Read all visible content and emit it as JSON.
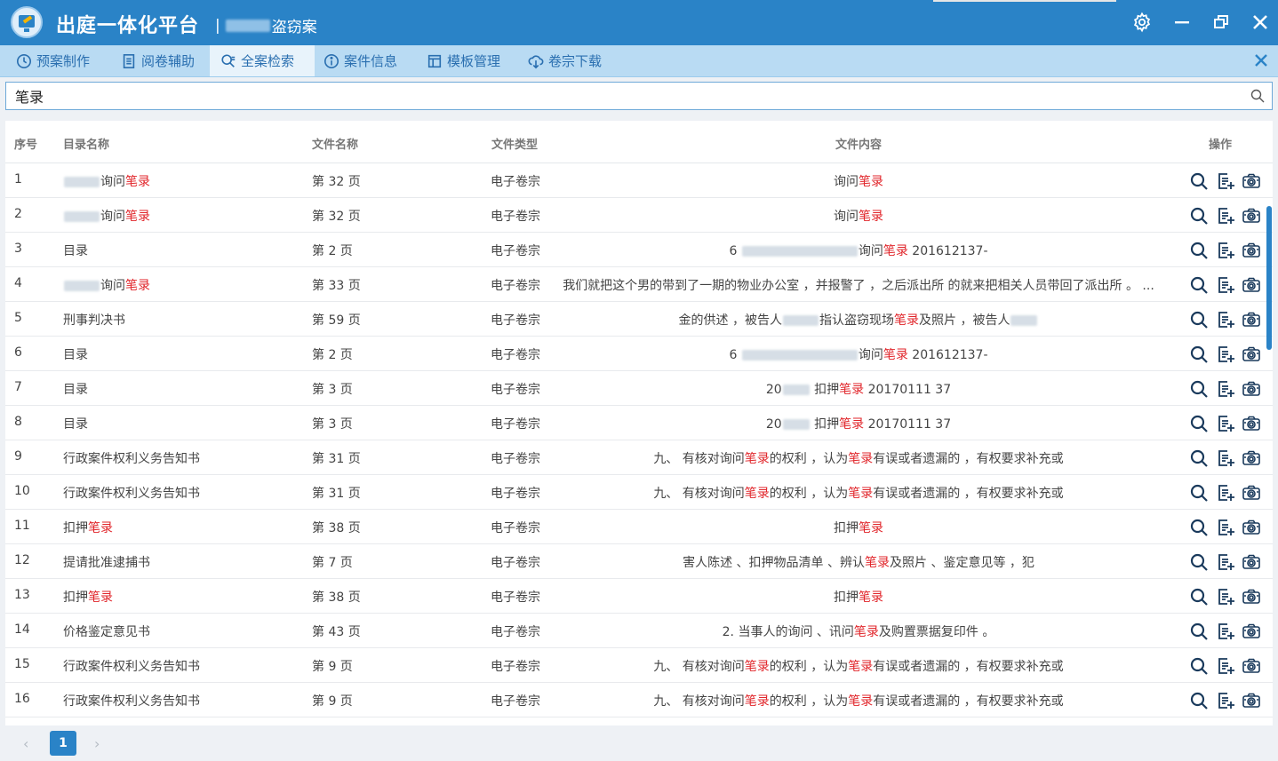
{
  "titlebar": {
    "app_title": "出庭一体化平台",
    "separator": "|",
    "case_title_suffix": "盗窃案",
    "settings_icon": "gear-icon",
    "minimize_icon": "minimize-icon",
    "maximize_icon": "restore-icon",
    "close_icon": "close-icon"
  },
  "tabs": [
    {
      "label": "预案制作",
      "icon": "clock-icon",
      "active": false
    },
    {
      "label": "阅卷辅助",
      "icon": "document-icon",
      "active": false
    },
    {
      "label": "全案检索",
      "icon": "search-doc-icon",
      "active": true
    },
    {
      "label": "案件信息",
      "icon": "info-icon",
      "active": false
    },
    {
      "label": "模板管理",
      "icon": "template-icon",
      "active": false
    },
    {
      "label": "卷宗下载",
      "icon": "cloud-download-icon",
      "active": false
    }
  ],
  "search": {
    "value": "笔录",
    "icon": "search-icon"
  },
  "table": {
    "headers": {
      "index": "序号",
      "catalog": "目录名称",
      "file_name": "文件名称",
      "file_type": "文件类型",
      "content": "文件内容",
      "actions": "操作"
    },
    "rows": [
      {
        "index": "1",
        "catalog": [
          "询问",
          "笔录"
        ],
        "catalog_blur": true,
        "file_name": "第 32 页",
        "file_type": "电子卷宗",
        "content": [
          "询问",
          "笔录"
        ]
      },
      {
        "index": "2",
        "catalog": [
          "询问",
          "笔录"
        ],
        "catalog_blur": true,
        "file_name": "第 32 页",
        "file_type": "电子卷宗",
        "content": [
          "询问",
          "笔录"
        ]
      },
      {
        "index": "3",
        "catalog": [
          "目录",
          ""
        ],
        "catalog_blur": false,
        "file_name": "第 2 页",
        "file_type": "电子卷宗",
        "content": [
          "6 ",
          "询问",
          "笔录",
          " 201612137-"
        ],
        "content_blur": true
      },
      {
        "index": "4",
        "catalog": [
          "询问",
          "笔录"
        ],
        "catalog_blur": true,
        "file_name": "第 33 页",
        "file_type": "电子卷宗",
        "content_plain": "我们就把这个男的带到了一期的物业办公室 ，并报警了 ，之后派出所 的就来把相关人员带回了派出所 。 ..."
      },
      {
        "index": "5",
        "catalog": [
          "刑事判决书",
          ""
        ],
        "catalog_blur": false,
        "file_name": "第 59 页",
        "file_type": "电子卷宗",
        "content": [
          "金的供述 ，被告人",
          "指认盗窃现场",
          "笔录",
          "及照片 ，被告人"
        ],
        "content_blur": true
      },
      {
        "index": "6",
        "catalog": [
          "目录",
          ""
        ],
        "catalog_blur": false,
        "file_name": "第 2 页",
        "file_type": "电子卷宗",
        "content": [
          "6 ",
          "询问",
          "笔录",
          " 201612137-"
        ],
        "content_blur": true
      },
      {
        "index": "7",
        "catalog": [
          "目录",
          ""
        ],
        "catalog_blur": false,
        "file_name": "第 3 页",
        "file_type": "电子卷宗",
        "content": [
          "20",
          " 扣押",
          "笔录",
          " 20170111 37"
        ],
        "content_blur": true
      },
      {
        "index": "8",
        "catalog": [
          "目录",
          ""
        ],
        "catalog_blur": false,
        "file_name": "第 3 页",
        "file_type": "电子卷宗",
        "content": [
          "20",
          " 扣押",
          "笔录",
          " 20170111 37"
        ],
        "content_blur": true
      },
      {
        "index": "9",
        "catalog": [
          "行政案件权利义务告知书",
          ""
        ],
        "catalog_blur": false,
        "file_name": "第 31 页",
        "file_type": "电子卷宗",
        "content_parts": [
          "九、 有核对询问",
          "笔录",
          "的权利 ，认为",
          "笔录",
          "有误或者遗漏的 ，有权要求补充或"
        ]
      },
      {
        "index": "10",
        "catalog": [
          "行政案件权利义务告知书",
          ""
        ],
        "catalog_blur": false,
        "file_name": "第 31 页",
        "file_type": "电子卷宗",
        "content_parts": [
          "九、 有核对询问",
          "笔录",
          "的权利 ，认为",
          "笔录",
          "有误或者遗漏的 ，有权要求补充或"
        ]
      },
      {
        "index": "11",
        "catalog": [
          "扣押",
          "笔录"
        ],
        "catalog_blur": false,
        "file_name": "第 38 页",
        "file_type": "电子卷宗",
        "content": [
          "扣押",
          "笔录"
        ]
      },
      {
        "index": "12",
        "catalog": [
          "提请批准逮捕书",
          ""
        ],
        "catalog_blur": false,
        "file_name": "第 7 页",
        "file_type": "电子卷宗",
        "content_parts": [
          "害人陈述 、扣押物品清单 、辨认",
          "笔录",
          "及照片 、鉴定意见等 ，犯"
        ]
      },
      {
        "index": "13",
        "catalog": [
          "扣押",
          "笔录"
        ],
        "catalog_blur": false,
        "file_name": "第 38 页",
        "file_type": "电子卷宗",
        "content": [
          "扣押",
          "笔录"
        ]
      },
      {
        "index": "14",
        "catalog": [
          "价格鉴定意见书",
          ""
        ],
        "catalog_blur": false,
        "file_name": "第 43 页",
        "file_type": "电子卷宗",
        "content_parts": [
          "2. 当事人的询问 、讯问",
          "笔录",
          "及购置票据复印件 。"
        ]
      },
      {
        "index": "15",
        "catalog": [
          "行政案件权利义务告知书",
          ""
        ],
        "catalog_blur": false,
        "file_name": "第 9 页",
        "file_type": "电子卷宗",
        "content_parts": [
          "九、 有核对询问",
          "笔录",
          "的权利 ，认为",
          "笔录",
          "有误或者遗漏的 ，有权要求补充或"
        ]
      },
      {
        "index": "16",
        "catalog": [
          "行政案件权利义务告知书",
          ""
        ],
        "catalog_blur": false,
        "file_name": "第 9 页",
        "file_type": "电子卷宗",
        "content_parts": [
          "九、 有核对询问",
          "笔录",
          "的权利 ，认为",
          "笔录",
          "有误或者遗漏的 ，有权要求补充或"
        ]
      }
    ],
    "row_action_icons": [
      "magnify-icon",
      "add-note-icon",
      "camera-icon"
    ]
  },
  "pagination": {
    "prev": "‹",
    "current": "1",
    "next": "›"
  },
  "colors": {
    "brand": "#2a83c7",
    "tabbar": "#b9dbf3",
    "highlight": "#e1262b"
  }
}
